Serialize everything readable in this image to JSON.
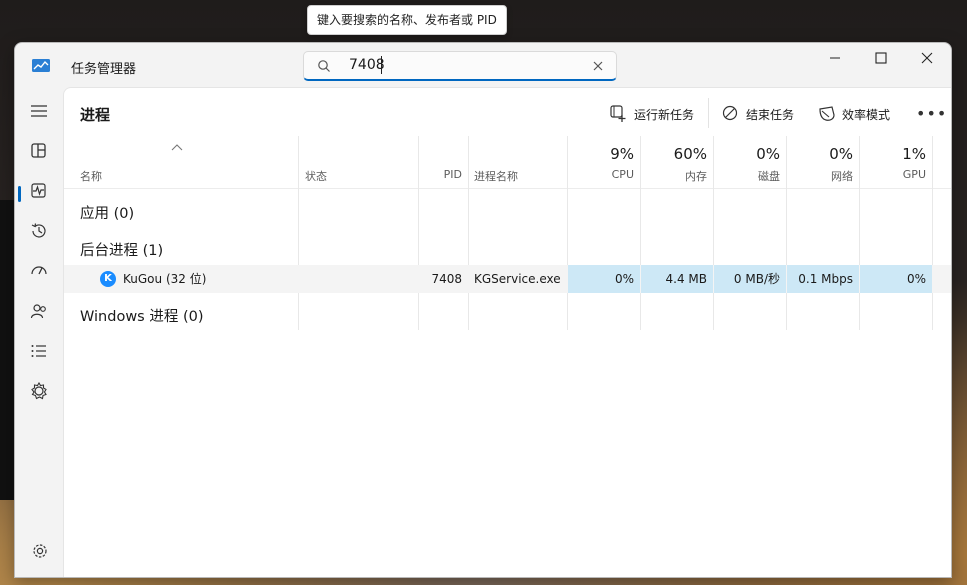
{
  "tooltip": "键入要搜索的名称、发布者或 PID",
  "window": {
    "title": "任务管理器"
  },
  "search": {
    "value": "7408",
    "placeholder": "键入要搜索的名称、发布者或 PID"
  },
  "page": {
    "title": "进程"
  },
  "commands": {
    "run_new_task": "运行新任务",
    "end_task": "结束任务",
    "efficiency_mode": "效率模式",
    "more": "•••"
  },
  "columns": {
    "name": "名称",
    "status": "状态",
    "pid": "PID",
    "process_name": "进程名称",
    "cpu": {
      "percent": "9%",
      "label": "CPU"
    },
    "memory": {
      "percent": "60%",
      "label": "内存"
    },
    "disk": {
      "percent": "0%",
      "label": "磁盘"
    },
    "network": {
      "percent": "0%",
      "label": "网络"
    },
    "gpu": {
      "percent": "1%",
      "label": "GPU"
    }
  },
  "groups": {
    "apps": "应用 (0)",
    "background": "后台进程 (1)",
    "windows": "Windows 进程 (0)"
  },
  "process": {
    "name": "KuGou (32 位)",
    "pid": "7408",
    "process_name": "KGService.exe",
    "cpu": "0%",
    "memory": "4.4 MB",
    "disk": "0 MB/秒",
    "network": "0.1 Mbps",
    "gpu": "0%",
    "icon_letter": "K"
  },
  "icons": {
    "nav": [
      "hamburger-icon",
      "processes-icon",
      "performance-icon",
      "app-history-icon",
      "startup-apps-icon",
      "users-icon",
      "details-icon",
      "services-icon",
      "settings-icon"
    ]
  },
  "colors": {
    "accent": "#0067c0",
    "heat": "#cde8f6",
    "kugou": "#1a8cff"
  }
}
